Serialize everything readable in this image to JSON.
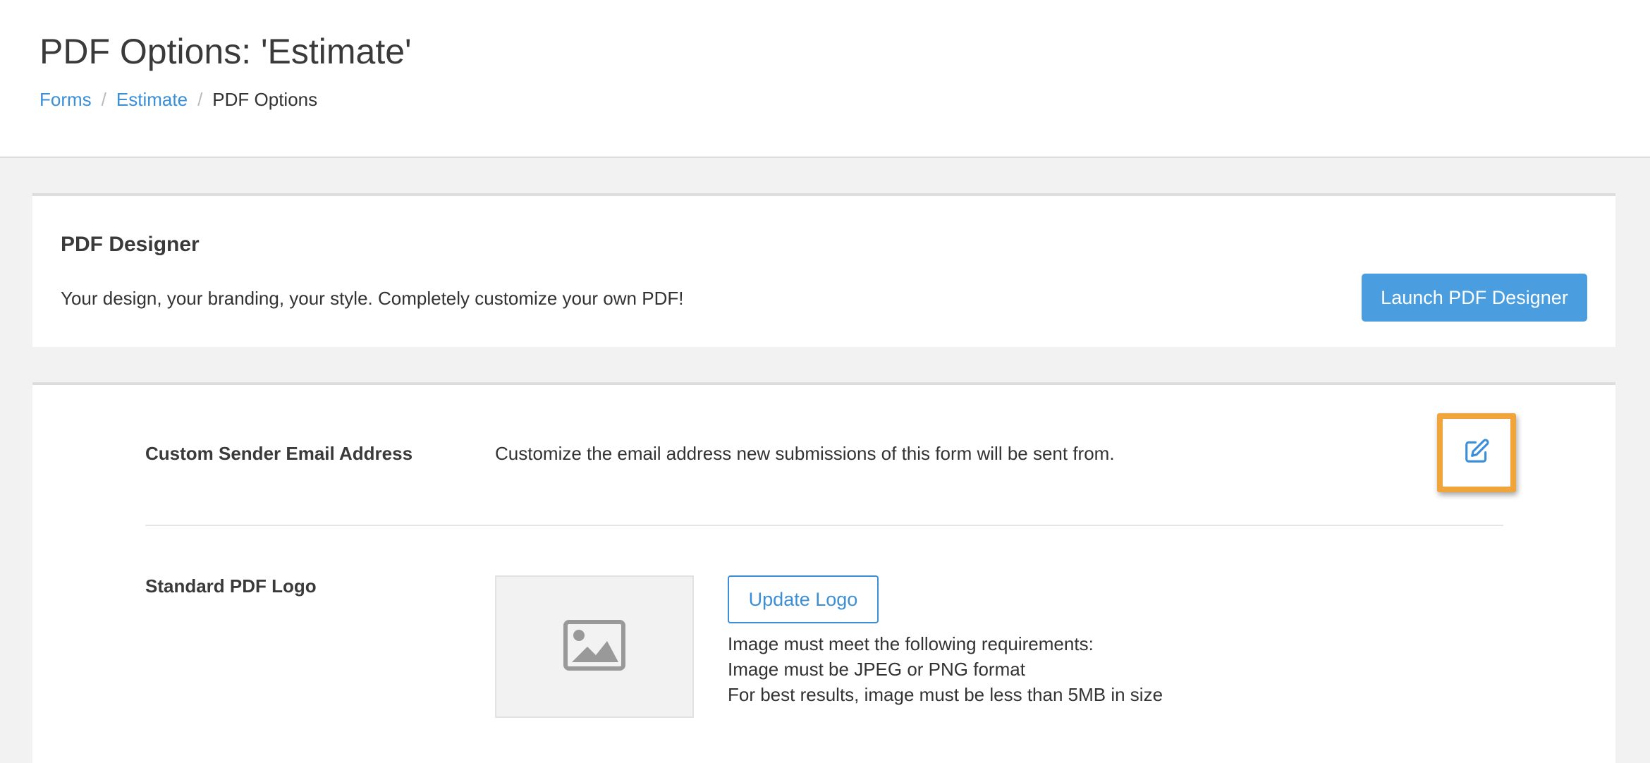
{
  "header": {
    "title": "PDF Options: 'Estimate'",
    "breadcrumb": [
      {
        "label": "Forms"
      },
      {
        "label": "Estimate"
      },
      {
        "label": "PDF Options"
      }
    ],
    "separator": "/"
  },
  "designer": {
    "title": "PDF Designer",
    "description": "Your design, your branding, your style. Completely customize your own PDF!",
    "launch_label": "Launch PDF Designer"
  },
  "sender_email": {
    "label": "Custom Sender Email Address",
    "description": "Customize the email address new submissions of this form will be sent from.",
    "edit_icon": "pencil-square-icon"
  },
  "logo": {
    "label": "Standard PDF Logo",
    "placeholder_icon": "image-icon",
    "update_label": "Update Logo",
    "requirements": [
      "Image must meet the following requirements:",
      "Image must be JPEG or PNG format",
      "For best results, image must be less than 5MB in size"
    ]
  },
  "colors": {
    "link": "#3a8fd8",
    "primary_button": "#4a9ee0",
    "highlight": "#f0a43a"
  }
}
